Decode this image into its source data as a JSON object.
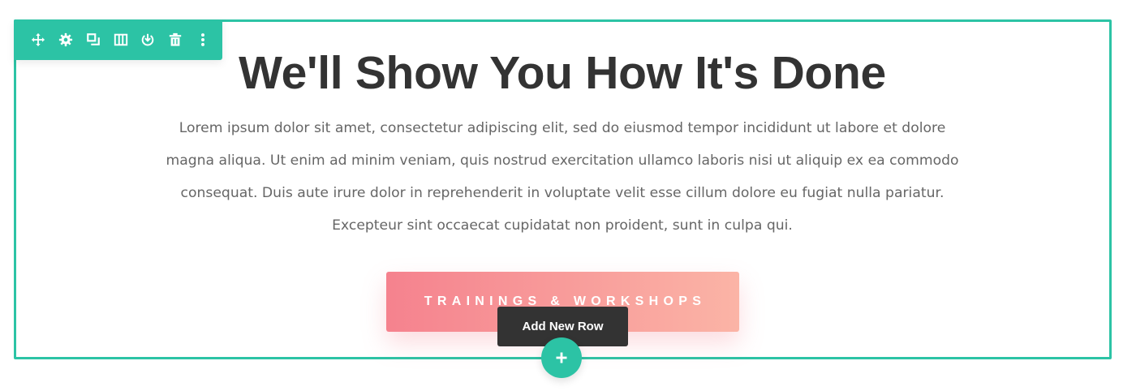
{
  "toolbar": {
    "color": "#2cc3a5",
    "buttons": [
      {
        "icon": "move-icon"
      },
      {
        "icon": "gear-icon"
      },
      {
        "icon": "duplicate-icon"
      },
      {
        "icon": "columns-icon"
      },
      {
        "icon": "save-to-library-icon"
      },
      {
        "icon": "trash-icon"
      },
      {
        "icon": "more-options-icon"
      }
    ]
  },
  "content": {
    "heading": "We'll Show You How It's Done",
    "body": "Lorem ipsum dolor sit amet, consectetur adipiscing elit, sed do eiusmod tempor incididunt ut labore et dolore magna aliqua. Ut enim ad minim veniam, quis nostrud exercitation ullamco laboris nisi ut aliquip ex ea commodo consequat. Duis aute irure dolor in reprehenderit in voluptate velit esse cillum dolore eu fugiat nulla pariatur. Excepteur sint occaecat cupidatat non proident, sunt in culpa qui.",
    "button_label": "TRAININGS & WORKSHOPS"
  },
  "add_row": {
    "tooltip": "Add New Row",
    "icon": "plus-icon"
  },
  "colors": {
    "accent": "#2cc3a5",
    "button_gradient_start": "#f5828e",
    "button_gradient_end": "#fbb4a6",
    "heading": "#333333",
    "body_text": "#666666"
  }
}
